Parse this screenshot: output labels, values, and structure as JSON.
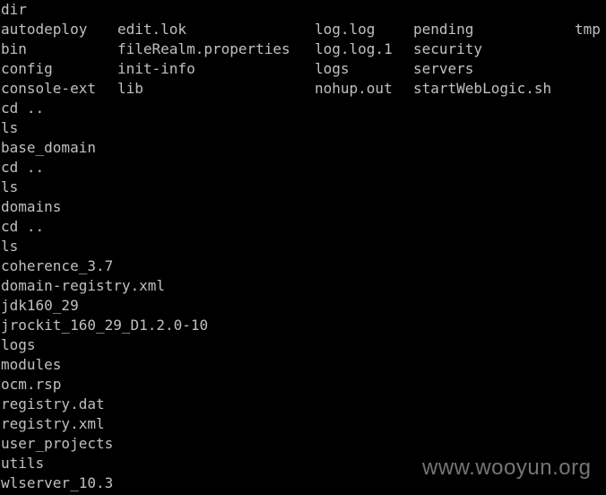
{
  "terminal": {
    "background": "#000000",
    "foreground": "#c0c0c0",
    "lines": [
      "dir",
      [
        "autodeploy",
        "edit.lok",
        "log.log",
        "pending",
        "tmp"
      ],
      [
        "bin",
        "fileRealm.properties",
        "log.log.1",
        "security"
      ],
      [
        "config",
        "init-info",
        "logs",
        "servers"
      ],
      [
        "console-ext",
        "lib",
        "nohup.out",
        "startWebLogic.sh"
      ],
      "cd ..",
      "ls",
      "base_domain",
      "cd ..",
      "ls",
      "domains",
      "cd ..",
      "ls",
      "coherence_3.7",
      "domain-registry.xml",
      "jdk160_29",
      "jrockit_160_29_D1.2.0-10",
      "logs",
      "modules",
      "ocm.rsp",
      "registry.dat",
      "registry.xml",
      "user_projects",
      "utils",
      "wlserver_10.3"
    ]
  },
  "watermark": {
    "text": "www.wooyun.org",
    "color": "#8a8a8a"
  }
}
